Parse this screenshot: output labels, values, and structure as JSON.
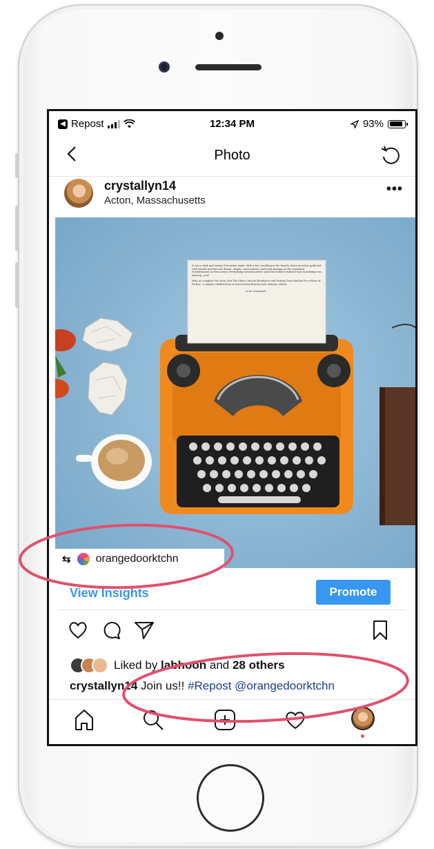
{
  "status_bar": {
    "back_app": "Repost",
    "time": "12:34 PM",
    "battery": "93%"
  },
  "nav": {
    "title": "Photo"
  },
  "post": {
    "username": "crystallyn14",
    "location": "Acton, Massachusetts",
    "more": "•••"
  },
  "repost_tag": {
    "account": "orangedoorktchn"
  },
  "insights": {
    "view_label": "View Insights",
    "promote_label": "Promote"
  },
  "likes": {
    "prefix": "Liked by ",
    "user": "labhoon",
    "middle": " and ",
    "others": "28 others"
  },
  "caption": {
    "username": "crystallyn14",
    "text": " Join us!! ",
    "tags": "#Repost @orangedoorktchn"
  },
  "typewriter_paper": {
    "para1": "It was a dark and stormy November night. With a fire crackling in the hearth, three novelists gathered with friends and fans for dinner, drinks, conversation, and book signings in the swankiest establishment in West Acton. Everything seemed perfect until the authors realized that something was missing...you!",
    "para2": "Help us complete the story. Join The Silver Unicorn Bookstore and Orange Door Kitchen for a Feast of Fiction - a unique collaboration at intersection literary and culinary culture.",
    "footer": "to be continued..."
  },
  "colors": {
    "accent_blue": "#3897f0",
    "annotation_pink": "#e0506e",
    "typewriter_orange": "#f08a1e",
    "photo_background": "#8fb8d4"
  },
  "icons": [
    "back-arrow-icon",
    "refresh-icon",
    "more-icon",
    "repost-icon",
    "heart-icon",
    "comment-icon",
    "share-icon",
    "bookmark-icon",
    "home-icon",
    "search-icon",
    "add-post-icon",
    "activity-heart-icon",
    "profile-avatar"
  ]
}
